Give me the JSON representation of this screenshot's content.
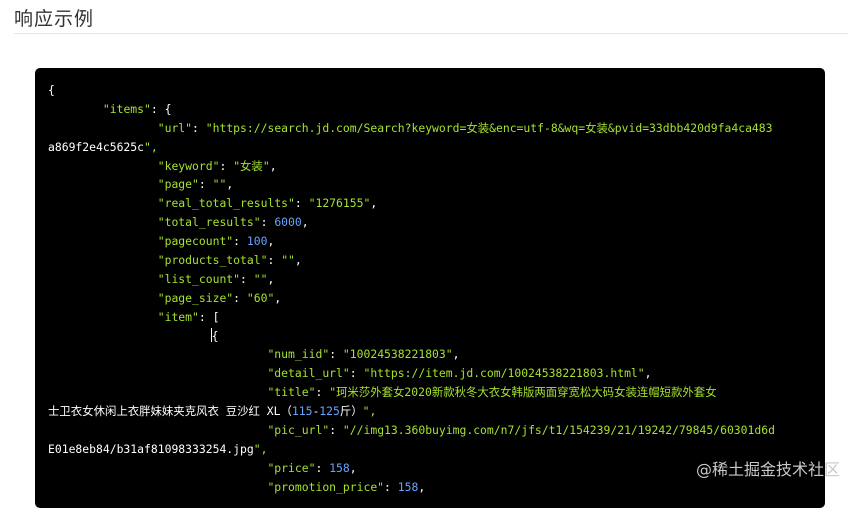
{
  "section": {
    "title": "响应示例"
  },
  "watermark": "@稀土掘金技术社区",
  "colors": {
    "code_bg": "#000000",
    "key": "#a6e22e",
    "string": "#a6e22e",
    "number": "#66a3ff"
  },
  "code_lines": [
    {
      "text": "{"
    },
    {
      "text": "        \"items\": {"
    },
    {
      "text": "                \"url\": \"https://search.jd.com/Search?keyword=女装&enc=utf-8&wq=女装&pvid=33dbb420d9fa4ca483"
    },
    {
      "text": "a869f2e4c5625c\","
    },
    {
      "text": "                \"keyword\": \"女装\","
    },
    {
      "text": "                \"page\": \"\","
    },
    {
      "text": "                \"real_total_results\": \"1276155\","
    },
    {
      "text": "                \"total_results\": 6000,"
    },
    {
      "text": "                \"pagecount\": 100,"
    },
    {
      "text": "                \"products_total\": \"\","
    },
    {
      "text": "                \"list_count\": \"\","
    },
    {
      "text": "                \"page_size\": \"60\","
    },
    {
      "text": "                \"item\": ["
    },
    {
      "text": "                        {"
    },
    {
      "text": "                                \"num_iid\": \"10024538221803\","
    },
    {
      "text": "                                \"detail_url\": \"https://item.jd.com/10024538221803.html\","
    },
    {
      "text": "                                \"title\": \"珂米莎外套女2020新款秋冬大衣女韩版两面穿宽松大码女装连帽短款外套女"
    },
    {
      "text": "士卫衣女休闲上衣胖妹妹夹克风衣 豆沙红 XL（115-125斤）\","
    },
    {
      "text": "                                \"pic_url\": \"//img13.360buyimg.com/n7/jfs/t1/154239/21/19242/79845/60301d6d"
    },
    {
      "text": "E01e8eb84/b31af81098333254.jpg\","
    },
    {
      "text": "                                \"price\": 158,"
    },
    {
      "text": "                                \"promotion_price\": 158,"
    }
  ]
}
